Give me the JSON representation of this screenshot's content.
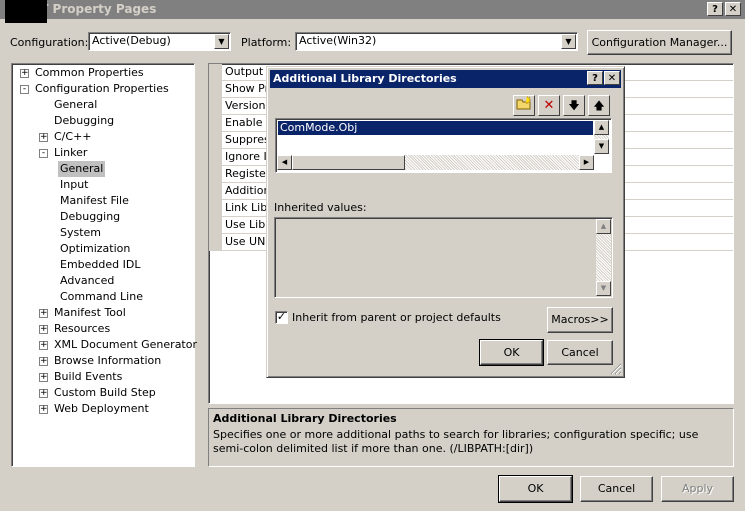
{
  "window": {
    "title": "ET Property Pages",
    "help_btn": "?",
    "close_btn": "✕"
  },
  "toolbar": {
    "configuration_label": "Configuration:",
    "configuration_value": "Active(Debug)",
    "platform_label": "Platform:",
    "platform_value": "Active(Win32)",
    "config_manager_label": "Configuration Manager..."
  },
  "tree": [
    {
      "label": "Common Properties",
      "exp": "+"
    },
    {
      "label": "Configuration Properties",
      "exp": "−"
    },
    {
      "label": "General",
      "exp": ""
    },
    {
      "label": "Debugging",
      "exp": ""
    },
    {
      "label": "C/C++",
      "exp": "+"
    },
    {
      "label": "Linker",
      "exp": "−"
    },
    {
      "label": "General",
      "exp": ""
    },
    {
      "label": "Input",
      "exp": ""
    },
    {
      "label": "Manifest File",
      "exp": ""
    },
    {
      "label": "Debugging",
      "exp": ""
    },
    {
      "label": "System",
      "exp": ""
    },
    {
      "label": "Optimization",
      "exp": ""
    },
    {
      "label": "Embedded IDL",
      "exp": ""
    },
    {
      "label": "Advanced",
      "exp": ""
    },
    {
      "label": "Command Line",
      "exp": ""
    },
    {
      "label": "Manifest Tool",
      "exp": "+"
    },
    {
      "label": "Resources",
      "exp": "+"
    },
    {
      "label": "XML Document Generator",
      "exp": "+"
    },
    {
      "label": "Browse Information",
      "exp": "+"
    },
    {
      "label": "Build Events",
      "exp": "+"
    },
    {
      "label": "Custom Build Step",
      "exp": "+"
    },
    {
      "label": "Web Deployment",
      "exp": "+"
    }
  ],
  "grid_rows": [
    "Output F",
    "Show Pr",
    "Version",
    "Enable In",
    "Suppres",
    "Ignore Ir",
    "Register",
    "Additiona",
    "Link Libra",
    "Use Libra",
    "Use UNI"
  ],
  "description": {
    "title": "Additional Library Directories",
    "text": "Specifies one or more additional paths to search for libraries; configuration specific; use semi-colon delimited list if more than one.     (/LIBPATH:[dir])"
  },
  "footer": {
    "ok": "OK",
    "cancel": "Cancel",
    "apply": "Apply"
  },
  "dialog": {
    "title": "Additional Library Directories",
    "help_btn": "?",
    "close_btn": "✕",
    "entry": "ComMode.Obj",
    "inherited_label": "Inherited values:",
    "inherit_checkbox_label": "Inherit from parent or project defaults",
    "inherit_checked": true,
    "macros": "Macros>>",
    "ok": "OK",
    "cancel": "Cancel"
  }
}
